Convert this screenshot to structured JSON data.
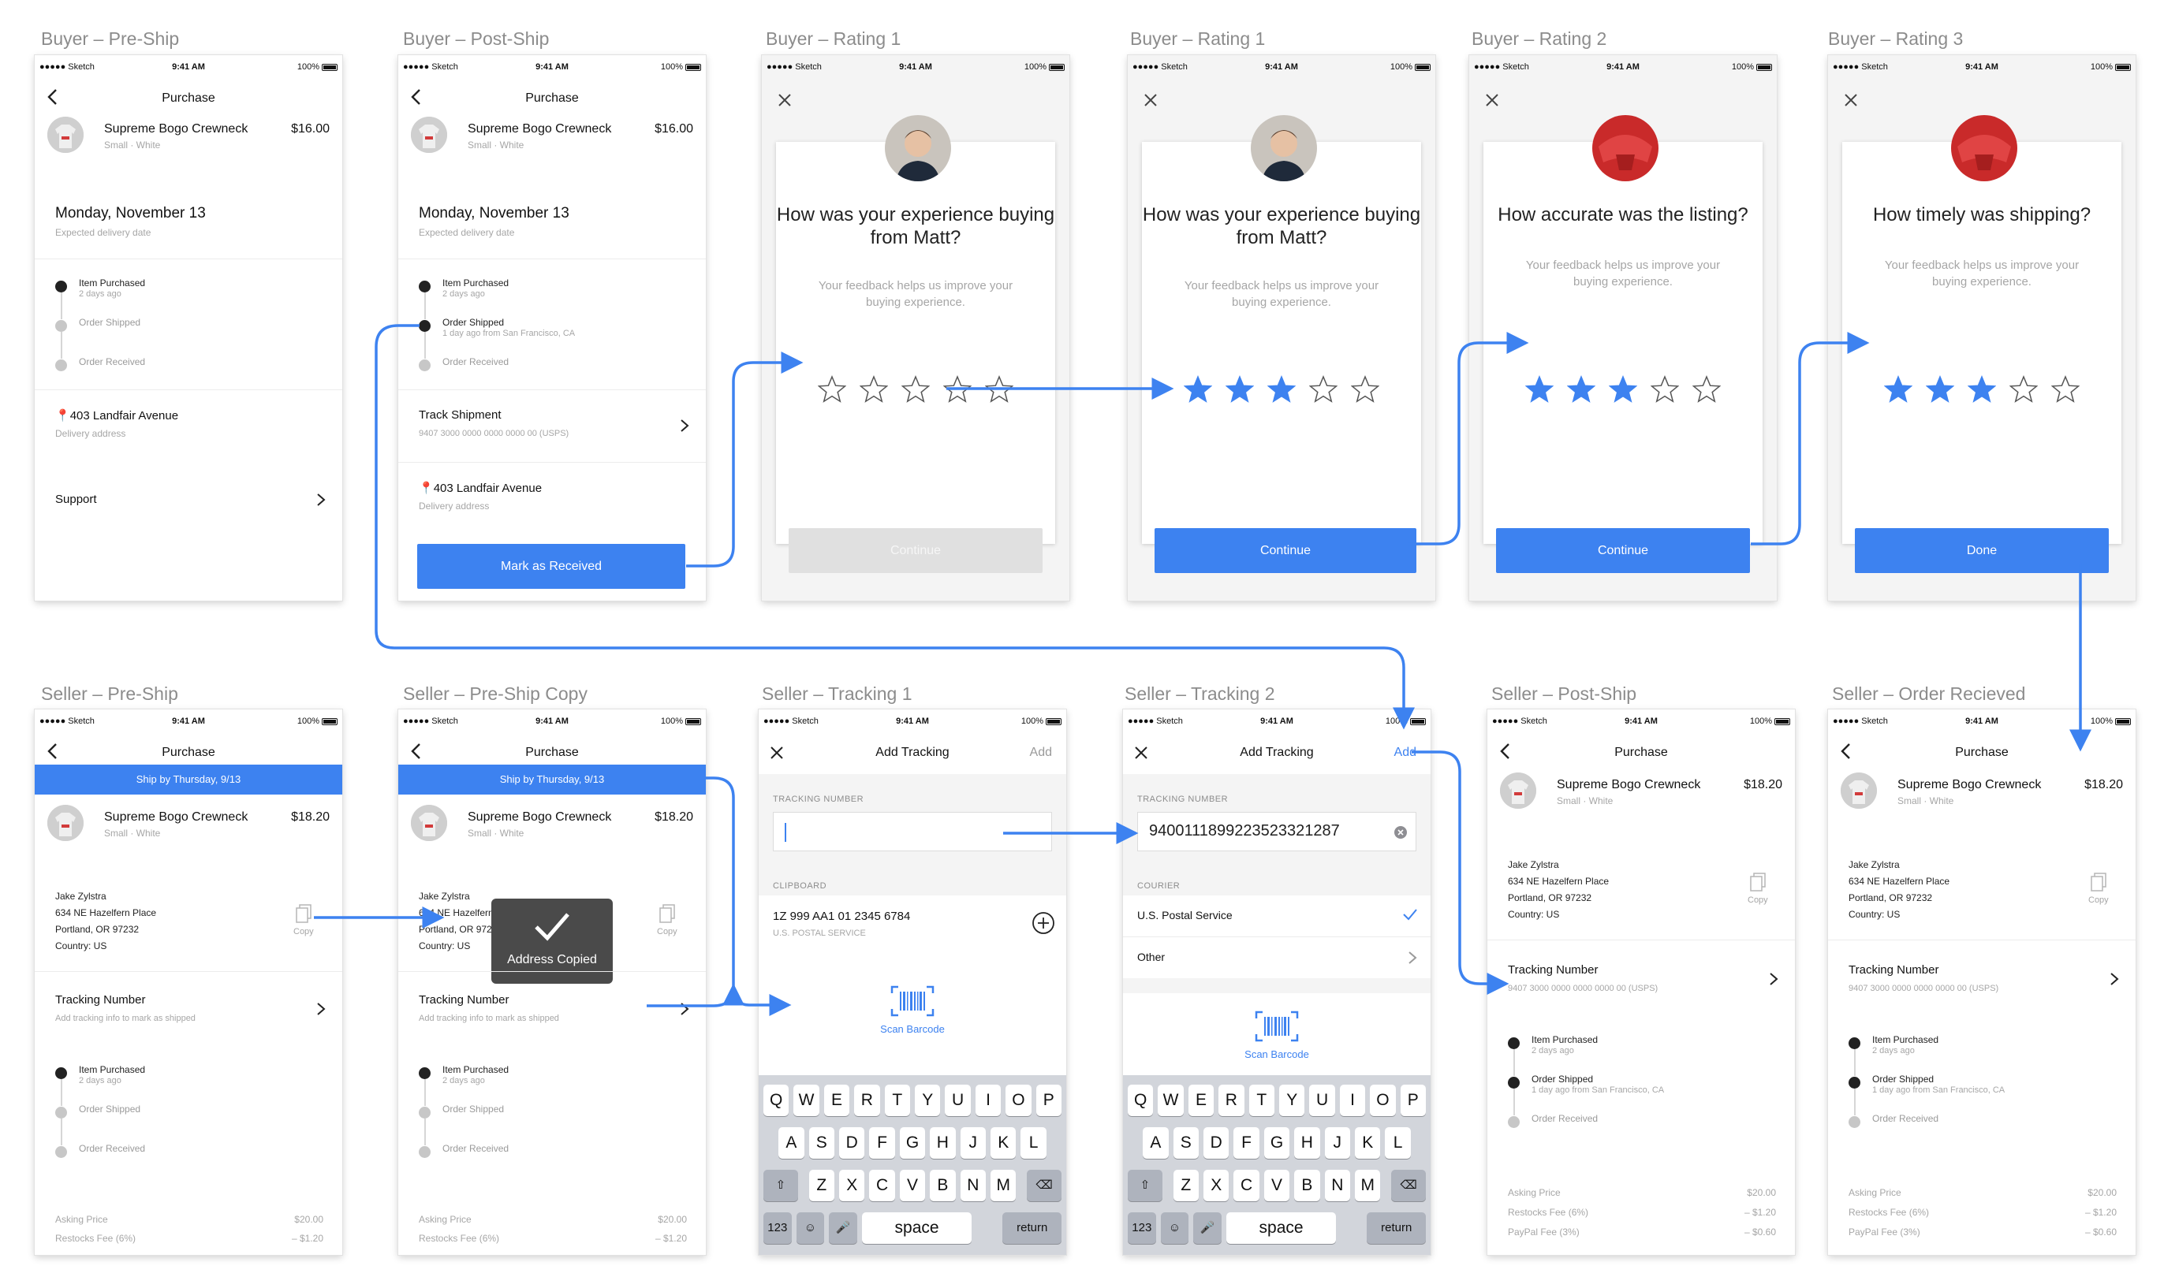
{
  "colors": {
    "accent": "#3d82f0",
    "arrow": "#3d82f0"
  },
  "status": {
    "carrier": "●●●●● Sketch",
    "time": "9:41 AM",
    "battery": "100%"
  },
  "frames": {
    "buyer_preship": "Buyer – Pre-Ship",
    "buyer_postship": "Buyer – Post-Ship",
    "buyer_rating1a": "Buyer – Rating 1",
    "buyer_rating1b": "Buyer – Rating 1",
    "buyer_rating2": "Buyer – Rating 2",
    "buyer_rating3": "Buyer – Rating 3",
    "seller_preship": "Seller – Pre-Ship",
    "seller_preship_copy": "Seller – Pre-Ship Copy",
    "seller_tracking1": "Seller – Tracking 1",
    "seller_tracking2": "Seller – Tracking 2",
    "seller_postship": "Seller – Post-Ship",
    "seller_received": "Seller – Order Recieved"
  },
  "common": {
    "purchase_title": "Purchase",
    "product_name": "Supreme Bogo Crewneck",
    "product_sub": "Small · White",
    "buyer_price": "$16.00",
    "seller_price": "$18.20",
    "delivery_date": "Monday, November 13",
    "delivery_caption": "Expected delivery date",
    "address": "403 Landfair Avenue",
    "address_caption": "Delivery address",
    "support": "Support",
    "track_shipment": "Track Shipment",
    "tracking_code": "9407 3000 0000 0000 0000 00 (USPS)",
    "mark_received": "Mark as Received",
    "ship_by": "Ship by Thursday, 9/13",
    "tracking_number": "Tracking Number",
    "tracking_hint": "Add tracking info to mark as shipped",
    "copy": "Copy",
    "address_copied": "Address Copied"
  },
  "ship_to": {
    "name": "Jake Zylstra",
    "line1": "634 NE Hazelfern Place",
    "line2": "Portland, OR 97232",
    "country": "Country: US"
  },
  "timeline": {
    "purchased": "Item Purchased",
    "purchased_sub": "2 days ago",
    "shipped": "Order Shipped",
    "shipped_sub": "1 day ago from San Francisco, CA",
    "received": "Order Received"
  },
  "fees": {
    "asking_label": "Asking Price",
    "asking_value": "$20.00",
    "restock_label": "Restocks Fee (6%)",
    "restock_value": "– $1.20",
    "paypal_label": "PayPal Fee (3%)",
    "paypal_value": "– $0.60"
  },
  "rating": {
    "q_experience": "How was your experience buying from Matt?",
    "q_accuracy": "How accurate was the listing?",
    "q_shipping": "How timely was shipping?",
    "feedback": "Your feedback helps us improve your buying experience.",
    "continue": "Continue",
    "done": "Done",
    "stars_rating1a": 0,
    "stars_rating1b": 3,
    "stars_rating2": 3,
    "stars_rating3": 3,
    "max_stars": 5
  },
  "tracking": {
    "title": "Add Tracking",
    "add": "Add",
    "tracking_label": "TRACKING NUMBER",
    "clipboard_label": "CLIPBOARD",
    "clipboard_value": "1Z 999 AA1 01 2345 6784",
    "clipboard_carrier": "U.S. POSTAL SERVICE",
    "scan_barcode": "Scan Barcode",
    "entered_number": "9400111899223523321287",
    "courier_label": "COURIER",
    "courier_usps": "U.S. Postal Service",
    "courier_other": "Other"
  },
  "keyboard": {
    "row1": [
      "Q",
      "W",
      "E",
      "R",
      "T",
      "Y",
      "U",
      "I",
      "O",
      "P"
    ],
    "row2": [
      "A",
      "S",
      "D",
      "F",
      "G",
      "H",
      "J",
      "K",
      "L"
    ],
    "row3": [
      "Z",
      "X",
      "C",
      "V",
      "B",
      "N",
      "M"
    ],
    "num": "123",
    "space": "space",
    "return": "return"
  }
}
